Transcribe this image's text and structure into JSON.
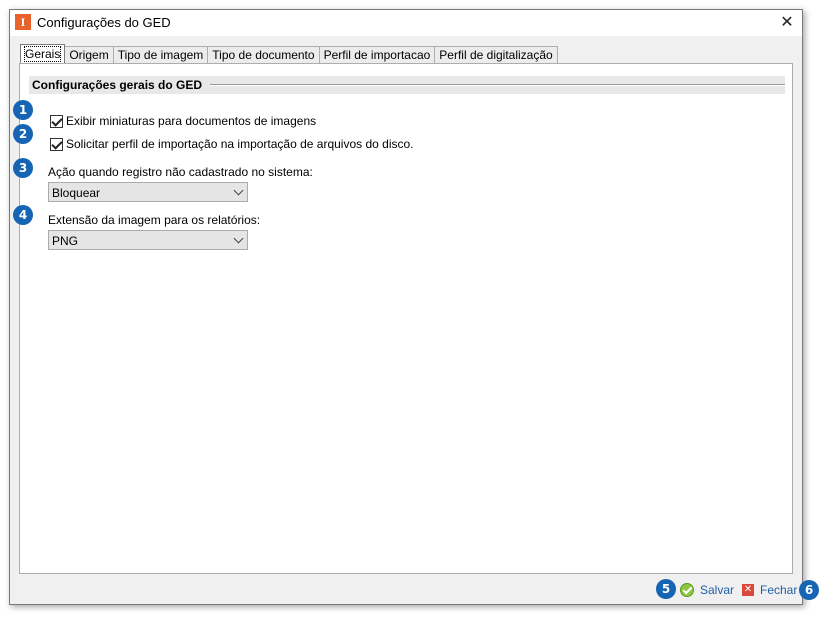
{
  "window": {
    "title": "Configurações do GED",
    "app_icon_letter": "I",
    "close_glyph": "✕"
  },
  "tabs": [
    {
      "label": "Gerais",
      "active": true
    },
    {
      "label": "Origem"
    },
    {
      "label": "Tipo de imagem"
    },
    {
      "label": "Tipo de documento"
    },
    {
      "label": "Perfil de importacao"
    },
    {
      "label": "Perfil de digitalização"
    }
  ],
  "group": {
    "title": "Configurações gerais do GED"
  },
  "options": [
    {
      "badge": "1",
      "label": "Exibir miniaturas para documentos de imagens",
      "checked": true
    },
    {
      "badge": "2",
      "label": "Solicitar perfil de importação na importação de arquivos do disco.",
      "checked": true
    }
  ],
  "fields": [
    {
      "badge": "3",
      "label": "Ação quando registro não cadastrado no sistema:",
      "value": "Bloquear"
    },
    {
      "badge": "4",
      "label": "Extensão da imagem para os relatórios:",
      "value": "PNG"
    }
  ],
  "footer": {
    "save_badge": "5",
    "save_label": "Salvar",
    "close_badge": "6",
    "close_label": "Fechar",
    "close_icon_glyph": "✕"
  },
  "colors": {
    "badge": "#1565b4",
    "link": "#1f5fa8",
    "app_icon": "#e8632b"
  }
}
